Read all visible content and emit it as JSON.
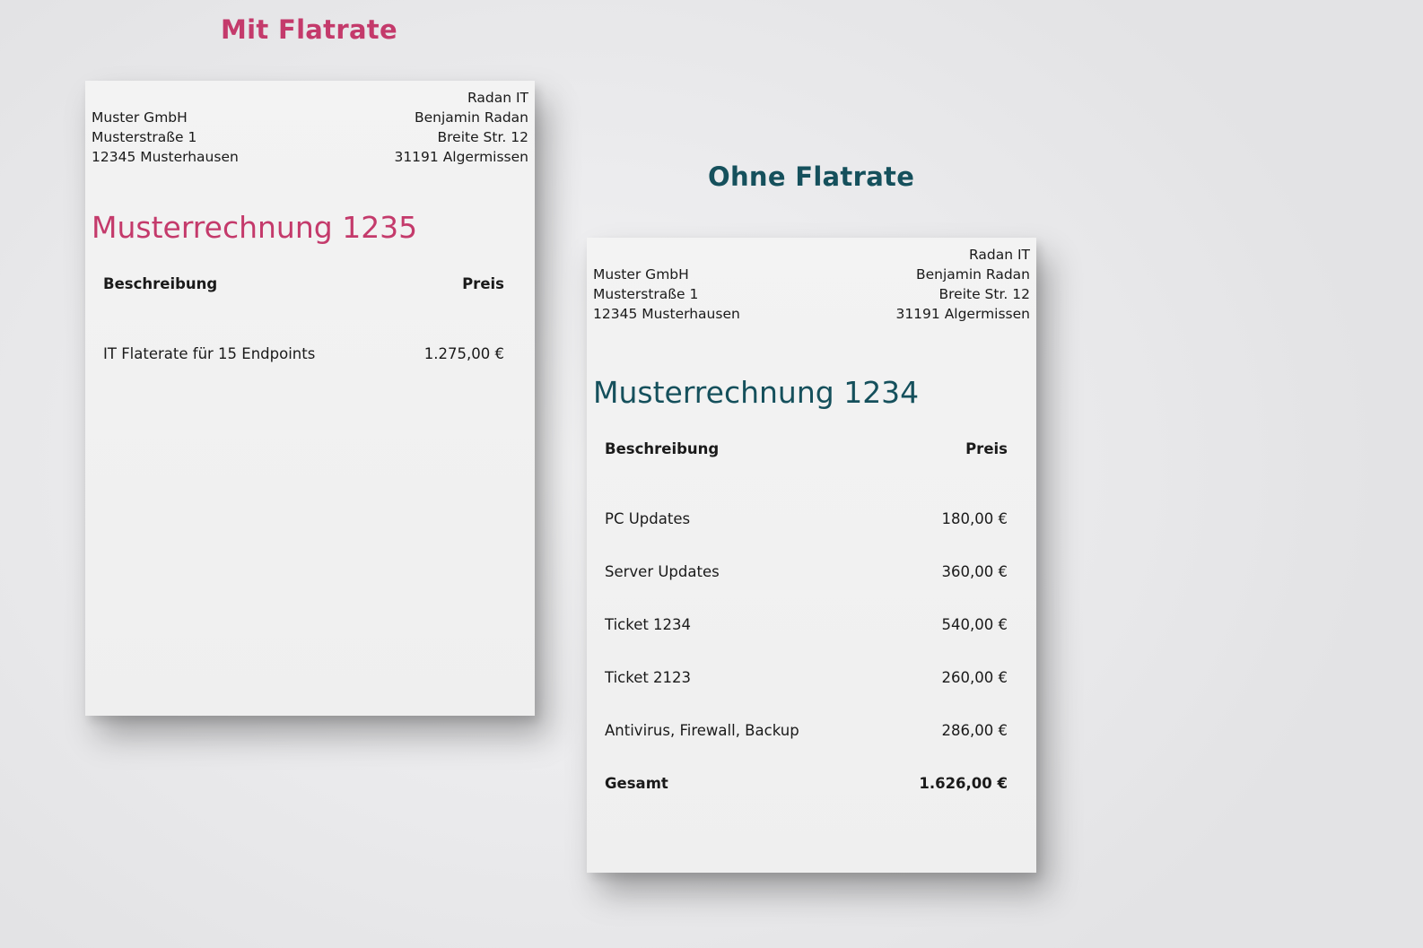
{
  "left": {
    "heading": "Mit Flatrate",
    "accent_color": "#c43a6b",
    "customer": {
      "company": "Muster GmbH",
      "street": "Musterstraße 1",
      "city": "12345 Musterhausen"
    },
    "vendor": {
      "company": "Radan IT",
      "name": "Benjamin Radan",
      "street": "Breite Str. 12",
      "city": "31191 Algermissen"
    },
    "invoice_title": "Musterrechnung 1235",
    "columns": {
      "description": "Beschreibung",
      "price": "Preis"
    },
    "items": [
      {
        "description": "IT Flaterate für 15 Endpoints",
        "price": "1.275,00 €"
      }
    ]
  },
  "right": {
    "heading": "Ohne Flatrate",
    "accent_color": "#15505c",
    "customer": {
      "company": "Muster GmbH",
      "street": "Musterstraße 1",
      "city": "12345 Musterhausen"
    },
    "vendor": {
      "company": "Radan IT",
      "name": "Benjamin Radan",
      "street": "Breite Str. 12",
      "city": "31191 Algermissen"
    },
    "invoice_title": "Musterrechnung 1234",
    "columns": {
      "description": "Beschreibung",
      "price": "Preis"
    },
    "items": [
      {
        "description": "PC Updates",
        "price": "180,00 €"
      },
      {
        "description": "Server Updates",
        "price": "360,00 €"
      },
      {
        "description": "Ticket 1234",
        "price": "540,00 €"
      },
      {
        "description": "Ticket 2123",
        "price": "260,00 €"
      },
      {
        "description": "Antivirus, Firewall, Backup",
        "price": "286,00 €"
      }
    ],
    "total": {
      "label": "Gesamt",
      "price": "1.626,00 €"
    }
  }
}
